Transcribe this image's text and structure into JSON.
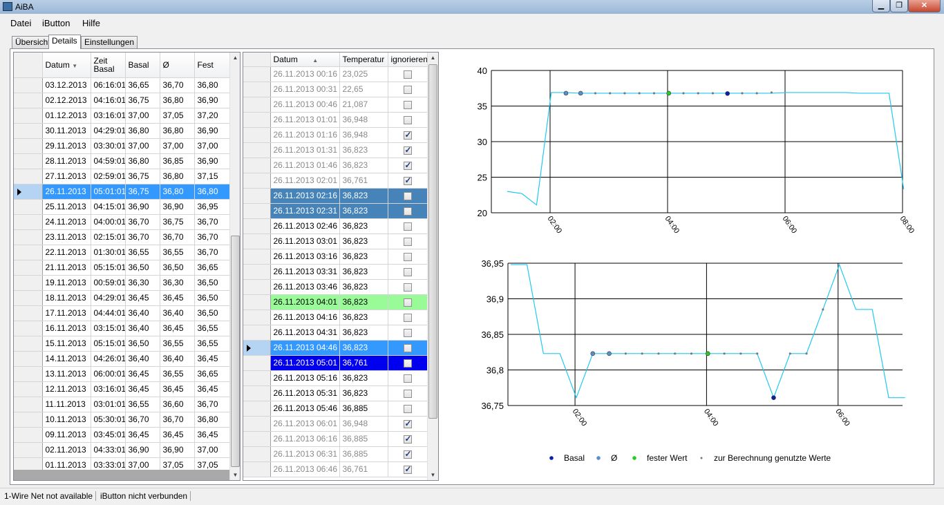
{
  "window": {
    "title": "AiBA",
    "min_label": "▁",
    "max_label": "❐",
    "close_label": "✕"
  },
  "menu": [
    "Datei",
    "iButton",
    "Hilfe"
  ],
  "tabs": [
    "Übersicht",
    "Details",
    "Einstellungen"
  ],
  "days_table": {
    "columns": [
      "Datum",
      "Zeit Basal",
      "Basal",
      "Ø",
      "Fest"
    ],
    "rows": [
      [
        "03.12.2013",
        "06:16:01",
        "36,65",
        "36,70",
        "36,80"
      ],
      [
        "02.12.2013",
        "04:16:01",
        "36,75",
        "36,80",
        "36,90"
      ],
      [
        "01.12.2013",
        "03:16:01",
        "37,00",
        "37,05",
        "37,20"
      ],
      [
        "30.11.2013",
        "04:29:01",
        "36,80",
        "36,80",
        "36,90"
      ],
      [
        "29.11.2013",
        "03:30:01",
        "37,00",
        "37,00",
        "37,00"
      ],
      [
        "28.11.2013",
        "04:59:01",
        "36,80",
        "36,85",
        "36,90"
      ],
      [
        "27.11.2013",
        "02:59:01",
        "36,75",
        "36,80",
        "37,15"
      ],
      [
        "26.11.2013",
        "05:01:01",
        "36,75",
        "36,80",
        "36,80"
      ],
      [
        "25.11.2013",
        "04:15:01",
        "36,90",
        "36,90",
        "36,95"
      ],
      [
        "24.11.2013",
        "04:00:01",
        "36,70",
        "36,75",
        "36,70"
      ],
      [
        "23.11.2013",
        "02:15:01",
        "36,70",
        "36,70",
        "36,70"
      ],
      [
        "22.11.2013",
        "01:30:01",
        "36,55",
        "36,55",
        "36,70"
      ],
      [
        "21.11.2013",
        "05:15:01",
        "36,50",
        "36,50",
        "36,65"
      ],
      [
        "19.11.2013",
        "00:59:01",
        "36,30",
        "36,30",
        "36,50"
      ],
      [
        "18.11.2013",
        "04:29:01",
        "36,45",
        "36,45",
        "36,50"
      ],
      [
        "17.11.2013",
        "04:44:01",
        "36,40",
        "36,40",
        "36,50"
      ],
      [
        "16.11.2013",
        "03:15:01",
        "36,40",
        "36,45",
        "36,55"
      ],
      [
        "15.11.2013",
        "05:15:01",
        "36,50",
        "36,55",
        "36,55"
      ],
      [
        "14.11.2013",
        "04:26:01",
        "36,40",
        "36,40",
        "36,45"
      ],
      [
        "13.11.2013",
        "06:00:01",
        "36,45",
        "36,55",
        "36,65"
      ],
      [
        "12.11.2013",
        "03:16:01",
        "36,45",
        "36,45",
        "36,45"
      ],
      [
        "11.11.2013",
        "03:01:01",
        "36,55",
        "36,60",
        "36,70"
      ],
      [
        "10.11.2013",
        "05:30:01",
        "36,70",
        "36,70",
        "36,80"
      ],
      [
        "09.11.2013",
        "03:45:01",
        "36,45",
        "36,45",
        "36,45"
      ],
      [
        "02.11.2013",
        "04:33:01",
        "36,90",
        "36,90",
        "37,00"
      ],
      [
        "01.11.2013",
        "03:33:01",
        "37,00",
        "37,05",
        "37,05"
      ]
    ],
    "selected_index": 7
  },
  "measure_table": {
    "columns": [
      "Datum",
      "Temperatur",
      "ignorieren"
    ],
    "rows": [
      {
        "d": "26.11.2013 00:16",
        "t": "23,025",
        "ign": false,
        "style": "dim"
      },
      {
        "d": "26.11.2013 00:31",
        "t": "22,65",
        "ign": false,
        "style": "dim"
      },
      {
        "d": "26.11.2013 00:46",
        "t": "21,087",
        "ign": false,
        "style": "dim"
      },
      {
        "d": "26.11.2013 01:01",
        "t": "36,948",
        "ign": false,
        "style": "dim"
      },
      {
        "d": "26.11.2013 01:16",
        "t": "36,948",
        "ign": true,
        "style": "dim"
      },
      {
        "d": "26.11.2013 01:31",
        "t": "36,823",
        "ign": true,
        "style": "dim"
      },
      {
        "d": "26.11.2013 01:46",
        "t": "36,823",
        "ign": true,
        "style": "dim"
      },
      {
        "d": "26.11.2013 02:01",
        "t": "36,761",
        "ign": true,
        "style": "dim"
      },
      {
        "d": "26.11.2013 02:16",
        "t": "36,823",
        "ign": false,
        "style": "dark"
      },
      {
        "d": "26.11.2013 02:31",
        "t": "36,823",
        "ign": false,
        "style": "dark"
      },
      {
        "d": "26.11.2013 02:46",
        "t": "36,823",
        "ign": false,
        "style": ""
      },
      {
        "d": "26.11.2013 03:01",
        "t": "36,823",
        "ign": false,
        "style": ""
      },
      {
        "d": "26.11.2013 03:16",
        "t": "36,823",
        "ign": false,
        "style": ""
      },
      {
        "d": "26.11.2013 03:31",
        "t": "36,823",
        "ign": false,
        "style": ""
      },
      {
        "d": "26.11.2013 03:46",
        "t": "36,823",
        "ign": false,
        "style": ""
      },
      {
        "d": "26.11.2013 04:01",
        "t": "36,823",
        "ign": false,
        "style": "green"
      },
      {
        "d": "26.11.2013 04:16",
        "t": "36,823",
        "ign": false,
        "style": ""
      },
      {
        "d": "26.11.2013 04:31",
        "t": "36,823",
        "ign": false,
        "style": ""
      },
      {
        "d": "26.11.2013 04:46",
        "t": "36,823",
        "ign": false,
        "style": "sel"
      },
      {
        "d": "26.11.2013 05:01",
        "t": "36,761",
        "ign": false,
        "style": "blue"
      },
      {
        "d": "26.11.2013 05:16",
        "t": "36,823",
        "ign": false,
        "style": ""
      },
      {
        "d": "26.11.2013 05:31",
        "t": "36,823",
        "ign": false,
        "style": ""
      },
      {
        "d": "26.11.2013 05:46",
        "t": "36,885",
        "ign": false,
        "style": ""
      },
      {
        "d": "26.11.2013 06:01",
        "t": "36,948",
        "ign": true,
        "style": "dim"
      },
      {
        "d": "26.11.2013 06:16",
        "t": "36,885",
        "ign": true,
        "style": "dim"
      },
      {
        "d": "26.11.2013 06:31",
        "t": "36,885",
        "ign": true,
        "style": "dim"
      },
      {
        "d": "26.11.2013 06:46",
        "t": "36,761",
        "ign": true,
        "style": "dim"
      }
    ],
    "current_row_index": 18
  },
  "chart_data": [
    {
      "type": "line",
      "x_unit": "hours",
      "xlim": [
        1.0,
        8.0
      ],
      "ylim": [
        20,
        40
      ],
      "xticks": [
        {
          "v": 2,
          "label": "02:00"
        },
        {
          "v": 4,
          "label": "04:00"
        },
        {
          "v": 6,
          "label": "06:00"
        },
        {
          "v": 8,
          "label": "08:00"
        }
      ],
      "yticks": [
        {
          "v": 20,
          "label": "20"
        },
        {
          "v": 25,
          "label": "25"
        },
        {
          "v": 30,
          "label": "30"
        },
        {
          "v": 35,
          "label": "35"
        },
        {
          "v": 40,
          "label": "40"
        }
      ],
      "series": [
        {
          "color": "#1ec8f0",
          "x": [
            1.27,
            1.52,
            1.77,
            2.02,
            2.27,
            2.52,
            2.77,
            3.02,
            3.27,
            3.52,
            3.77,
            4.02,
            4.27,
            4.52,
            4.77,
            5.02,
            5.27,
            5.52,
            5.77,
            6.02,
            6.27,
            6.52,
            6.77,
            7.02,
            7.27,
            7.52,
            7.77,
            8.02
          ],
          "y": [
            23.0,
            22.7,
            21.1,
            36.9,
            36.9,
            36.8,
            36.8,
            36.8,
            36.8,
            36.8,
            36.8,
            36.8,
            36.8,
            36.8,
            36.8,
            36.8,
            36.8,
            36.8,
            36.8,
            36.9,
            36.9,
            36.9,
            36.9,
            36.9,
            36.8,
            36.8,
            36.8,
            23.3
          ]
        }
      ],
      "markers": [
        {
          "x": 2.27,
          "y": 36.8,
          "kind": "avg"
        },
        {
          "x": 2.52,
          "y": 36.8,
          "kind": "avg"
        },
        {
          "x": 2.77,
          "y": 36.8,
          "kind": "used"
        },
        {
          "x": 3.02,
          "y": 36.8,
          "kind": "used"
        },
        {
          "x": 3.27,
          "y": 36.8,
          "kind": "used"
        },
        {
          "x": 3.52,
          "y": 36.8,
          "kind": "used"
        },
        {
          "x": 3.77,
          "y": 36.8,
          "kind": "used"
        },
        {
          "x": 4.02,
          "y": 36.8,
          "kind": "fixed"
        },
        {
          "x": 4.27,
          "y": 36.8,
          "kind": "used"
        },
        {
          "x": 4.52,
          "y": 36.8,
          "kind": "used"
        },
        {
          "x": 4.77,
          "y": 36.8,
          "kind": "used"
        },
        {
          "x": 5.02,
          "y": 36.76,
          "kind": "basal"
        },
        {
          "x": 5.27,
          "y": 36.8,
          "kind": "used"
        },
        {
          "x": 5.52,
          "y": 36.8,
          "kind": "used"
        },
        {
          "x": 5.77,
          "y": 36.9,
          "kind": "used"
        }
      ]
    },
    {
      "type": "line",
      "x_unit": "hours",
      "xlim": [
        0.98,
        6.98
      ],
      "ylim": [
        36.75,
        36.95
      ],
      "xticks": [
        {
          "v": 2,
          "label": "02:00"
        },
        {
          "v": 4,
          "label": "04:00"
        },
        {
          "v": 6,
          "label": "06:00"
        }
      ],
      "yticks": [
        {
          "v": 36.75,
          "label": "36,75"
        },
        {
          "v": 36.8,
          "label": "36,8"
        },
        {
          "v": 36.85,
          "label": "36,85"
        },
        {
          "v": 36.9,
          "label": "36,9"
        },
        {
          "v": 36.95,
          "label": "36,95"
        }
      ],
      "series": [
        {
          "color": "#1ec8f0",
          "x": [
            1.02,
            1.27,
            1.52,
            1.77,
            2.02,
            2.27,
            2.52,
            2.77,
            3.02,
            3.27,
            3.52,
            3.77,
            4.02,
            4.27,
            4.52,
            4.77,
            5.02,
            5.27,
            5.52,
            5.77,
            6.02,
            6.27,
            6.52,
            6.77,
            7.02
          ],
          "y": [
            36.948,
            36.948,
            36.823,
            36.823,
            36.761,
            36.823,
            36.823,
            36.823,
            36.823,
            36.823,
            36.823,
            36.823,
            36.823,
            36.823,
            36.823,
            36.823,
            36.761,
            36.823,
            36.823,
            36.885,
            36.948,
            36.885,
            36.885,
            36.761,
            36.761
          ]
        }
      ],
      "markers": [
        {
          "x": 2.27,
          "y": 36.823,
          "kind": "avg"
        },
        {
          "x": 2.52,
          "y": 36.823,
          "kind": "avg"
        },
        {
          "x": 2.77,
          "y": 36.823,
          "kind": "used"
        },
        {
          "x": 3.02,
          "y": 36.823,
          "kind": "used"
        },
        {
          "x": 3.27,
          "y": 36.823,
          "kind": "used"
        },
        {
          "x": 3.52,
          "y": 36.823,
          "kind": "used"
        },
        {
          "x": 3.77,
          "y": 36.823,
          "kind": "used"
        },
        {
          "x": 4.02,
          "y": 36.823,
          "kind": "fixed"
        },
        {
          "x": 4.27,
          "y": 36.823,
          "kind": "used"
        },
        {
          "x": 4.52,
          "y": 36.823,
          "kind": "used"
        },
        {
          "x": 4.77,
          "y": 36.823,
          "kind": "used"
        },
        {
          "x": 5.02,
          "y": 36.761,
          "kind": "basal"
        },
        {
          "x": 5.27,
          "y": 36.823,
          "kind": "used"
        },
        {
          "x": 5.52,
          "y": 36.823,
          "kind": "used"
        },
        {
          "x": 5.77,
          "y": 36.885,
          "kind": "used"
        }
      ]
    }
  ],
  "legend": [
    {
      "label": "Basal",
      "color": "#0a1fa8",
      "kind": "basal"
    },
    {
      "label": "Ø",
      "color": "#5b8fc9",
      "kind": "avg"
    },
    {
      "label": "fester Wert",
      "color": "#22cc22",
      "kind": "fixed"
    },
    {
      "label": "zur Berechnung genutzte Werte",
      "color": "#777777",
      "kind": "used"
    }
  ],
  "marker_colors": {
    "basal": "#0a1fa8",
    "avg": "#5b8fc9",
    "fixed": "#22cc22",
    "used": "#777777",
    "line": "#1ec8f0"
  },
  "status": [
    "1-Wire Net not available",
    "iButton nicht verbunden"
  ]
}
